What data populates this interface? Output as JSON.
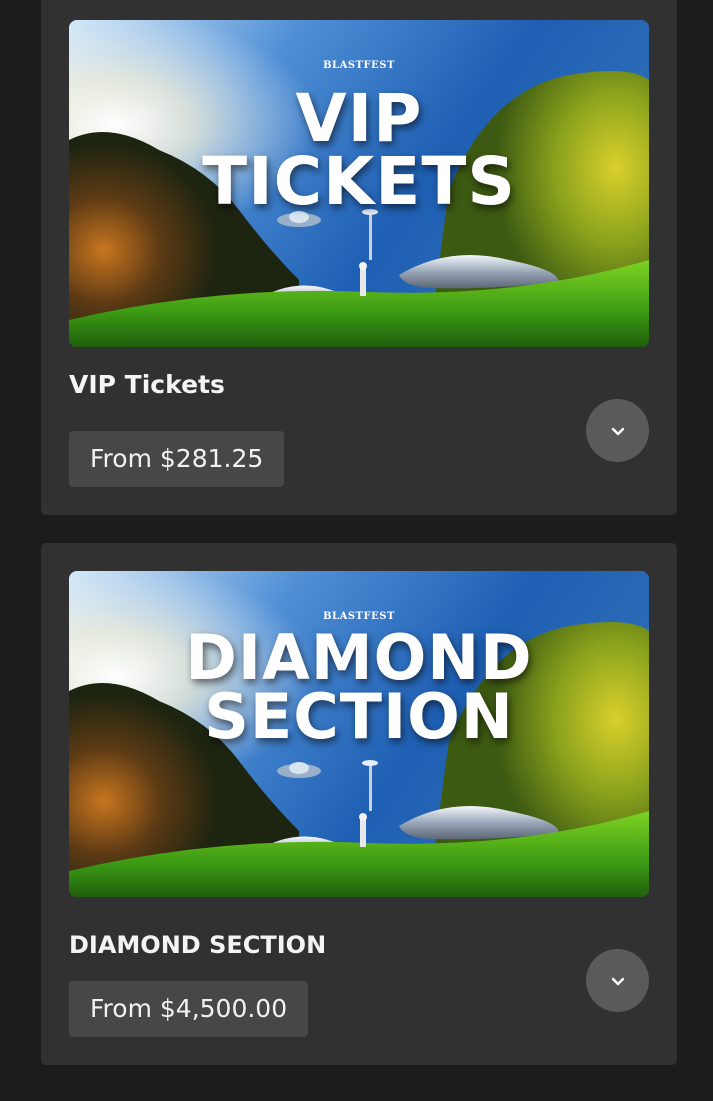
{
  "tickets": [
    {
      "brand": "BLASTFEST",
      "banner_lines": [
        "VIP",
        "TICKETS"
      ],
      "name": "VIP Tickets",
      "price": "From $281.25",
      "expand_icon": "chevron-down-icon"
    },
    {
      "brand": "BLASTFEST",
      "banner_lines": [
        "DIAMOND",
        "SECTION"
      ],
      "name": "DIAMOND SECTION",
      "price": "From $4,500.00",
      "expand_icon": "chevron-down-icon"
    }
  ],
  "colors": {
    "page_background": "#1c1c1c",
    "card_background": "#313131",
    "price_pill": "#474747",
    "expand_button": "#5a5a5a",
    "text": "#f2f2f2"
  }
}
